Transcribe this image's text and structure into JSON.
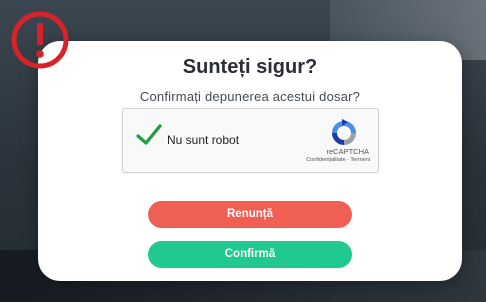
{
  "dialog": {
    "title": "Sunteți sigur?",
    "subtitle": "Confirmați depunerea acestui dosar?"
  },
  "recaptcha": {
    "label": "Nu sunt robot",
    "brand": "reCAPTCHA",
    "links": "Confidențialitate - Termeni",
    "checked": true
  },
  "buttons": {
    "cancel_label": "Renunță",
    "confirm_label": "Confirmă"
  },
  "colors": {
    "cancel": "#ef5f54",
    "confirm": "#21c98e",
    "alert": "#d8222a",
    "check": "#1e9e3e"
  },
  "icons": {
    "alert": "exclamation-circle-icon",
    "check": "checkmark-icon",
    "recaptcha": "recaptcha-logo-icon"
  }
}
